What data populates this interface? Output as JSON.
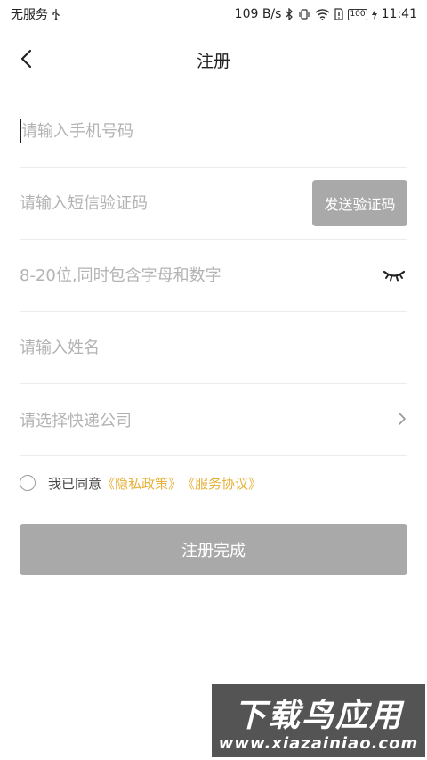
{
  "status_bar": {
    "carrier": "无服务",
    "speed": "109 B/s",
    "battery": "100",
    "time": "11:41"
  },
  "header": {
    "title": "注册"
  },
  "form": {
    "phone_placeholder": "请输入手机号码",
    "code_placeholder": "请输入短信验证码",
    "send_code_label": "发送验证码",
    "password_placeholder": "8-20位,同时包含字母和数字",
    "name_placeholder": "请输入姓名",
    "courier_placeholder": "请选择快递公司"
  },
  "agreement": {
    "prefix": "我已同意",
    "privacy_link": "《隐私政策》",
    "service_link": "《服务协议》",
    "link_color": "#e6b23b"
  },
  "submit_label": "注册完成",
  "watermark": {
    "title": "下载鸟应用",
    "url": "www.xiazainiao.com"
  }
}
